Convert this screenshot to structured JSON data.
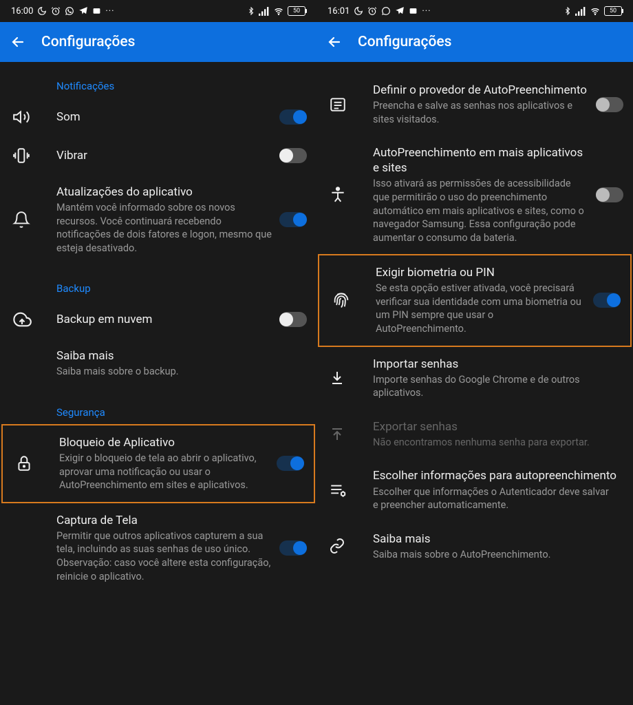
{
  "left": {
    "status": {
      "time": "16:00",
      "battery": "50"
    },
    "header": {
      "title": "Configurações"
    },
    "sections": {
      "notifications": {
        "label": "Notificações"
      },
      "backup": {
        "label": "Backup"
      },
      "security": {
        "label": "Segurança"
      }
    },
    "rows": {
      "sound": {
        "title": "Som"
      },
      "vibrate": {
        "title": "Vibrar"
      },
      "appUpdates": {
        "title": "Atualizações do aplicativo",
        "sub": "Mantém você informado sobre os novos recursos. Você continuará recebendo notificações de dois fatores e logon, mesmo que esteja desativado."
      },
      "cloudBackup": {
        "title": "Backup em nuvem"
      },
      "learnMore": {
        "title": "Saiba mais",
        "sub": "Saiba mais sobre o backup."
      },
      "appLock": {
        "title": "Bloqueio de Aplicativo",
        "sub": "Exigir o bloqueio de tela ao abrir o aplicativo, aprovar uma notificação ou usar o AutoPreenchimento em sites e aplicativos."
      },
      "screenCapture": {
        "title": "Captura de Tela",
        "sub": "Permitir que outros aplicativos capturem a sua tela, incluindo as suas senhas de uso único. Observação: caso você altere esta configuração, reinicie o aplicativo."
      }
    }
  },
  "right": {
    "status": {
      "time": "16:01",
      "battery": "50"
    },
    "header": {
      "title": "Configurações"
    },
    "rows": {
      "autofillProvider": {
        "title": "Definir o provedor de AutoPreenchimento",
        "sub": "Preencha e salve as senhas nos aplicativos e sites visitados."
      },
      "autofillMore": {
        "title": "AutoPreenchimento em mais aplicativos e sites",
        "sub": "Isso ativará as permissões de acessibilidade que permitirão o uso do preenchimento automático em mais aplicativos e sites, como o navegador Samsung. Essa configuração pode aumentar o consumo da bateria."
      },
      "biometric": {
        "title": "Exigir biometria ou PIN",
        "sub": "Se esta opção estiver ativada, você precisará verificar sua identidade com uma biometria ou um PIN sempre que usar o AutoPreenchimento."
      },
      "import": {
        "title": "Importar senhas",
        "sub": "Importe senhas do Google Chrome e de outros aplicativos."
      },
      "export": {
        "title": "Exportar senhas",
        "sub": "Não encontramos nenhuma senha para exportar."
      },
      "chooseInfo": {
        "title": "Escolher informações para autopreenchimento",
        "sub": "Escolher que informações o Autenticador deve salvar e preencher automaticamente."
      },
      "learnMore": {
        "title": "Saiba mais",
        "sub": "Saiba mais sobre o AutoPreenchimento."
      }
    }
  }
}
